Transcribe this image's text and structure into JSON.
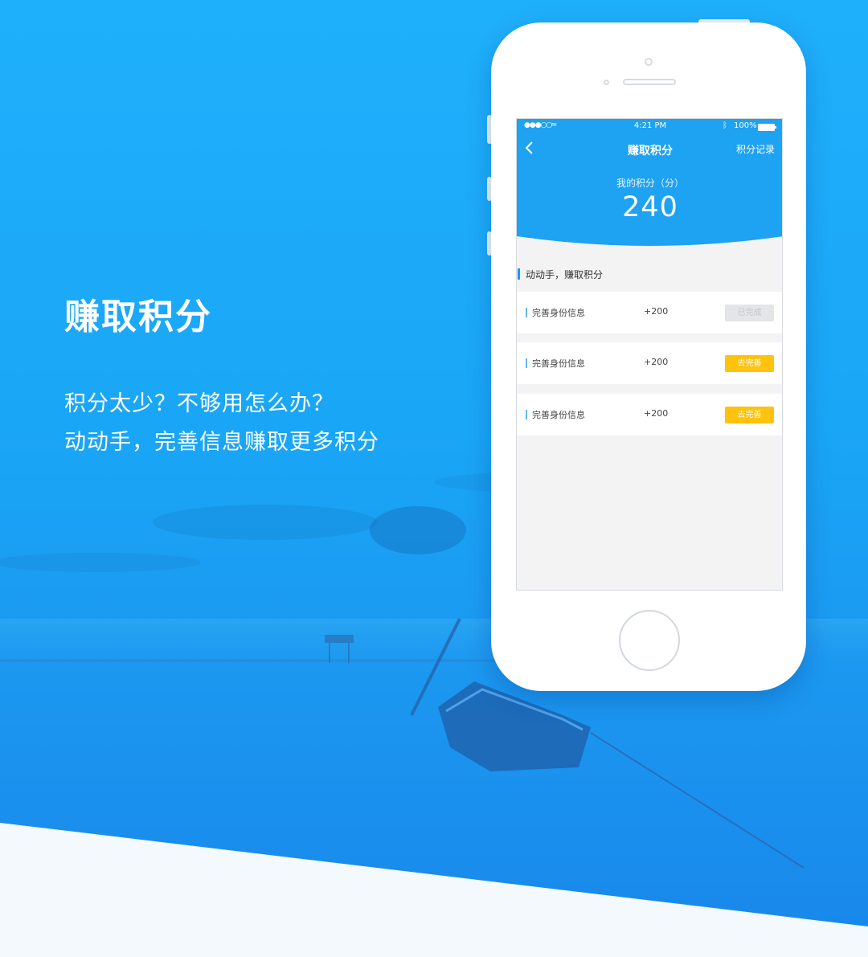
{
  "colors": {
    "brand_blue": "#1aa3f3",
    "header_blue": "#1ea2f2",
    "action_yellow": "#ffc20e",
    "done_gray": "#e3e5e8"
  },
  "promo": {
    "headline": "赚取积分",
    "line1": "积分太少？不够用怎么办？",
    "line2": "动动手，完善信息赚取更多积分"
  },
  "status_bar": {
    "signal": "●●●○○",
    "wifi_icon": "wifi-icon",
    "time": "4:21 PM",
    "bluetooth_icon": "bluetooth-icon",
    "battery": "100%"
  },
  "nav": {
    "back_icon": "chevron-left-icon",
    "title": "赚取积分",
    "right_link": "积分记录"
  },
  "points": {
    "label": "我的积分（分）",
    "value": "240"
  },
  "section": {
    "title": "动动手，赚取积分"
  },
  "tasks": [
    {
      "name": "完善身份信息",
      "points": "+200",
      "action": "已完成",
      "state": "done"
    },
    {
      "name": "完善身份信息",
      "points": "+200",
      "action": "去完善",
      "state": "todo"
    },
    {
      "name": "完善身份信息",
      "points": "+200",
      "action": "去完善",
      "state": "todo"
    }
  ]
}
